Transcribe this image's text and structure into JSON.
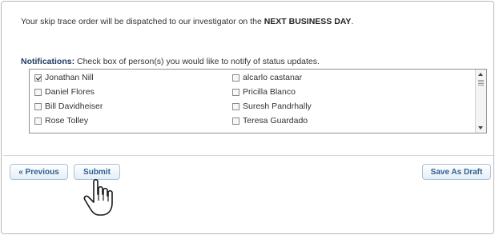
{
  "dispatch": {
    "prefix": "Your skip trace order will be dispatched to our investigator on the ",
    "emphasis": "NEXT BUSINESS DAY",
    "suffix": "."
  },
  "notifications": {
    "label": "Notifications:",
    "instruction": " Check box of person(s) you would like to notify of status updates.",
    "people": [
      {
        "name": "Jonathan Nill",
        "checked": true
      },
      {
        "name": "Daniel Flores",
        "checked": false
      },
      {
        "name": "Bill Davidheiser",
        "checked": false
      },
      {
        "name": "Rose Tolley",
        "checked": false
      },
      {
        "name": "alcarlo castanar",
        "checked": false
      },
      {
        "name": "Pricilla Blanco",
        "checked": false
      },
      {
        "name": "Suresh Pandrhally",
        "checked": false
      },
      {
        "name": "Teresa Guardado",
        "checked": false
      }
    ]
  },
  "buttons": {
    "previous": "« Previous",
    "submit": "Submit",
    "save_draft": "Save As Draft"
  },
  "colors": {
    "button_text": "#2e5f91",
    "button_border": "#a9c1d9",
    "label_text": "#1f3b63"
  },
  "icons": {
    "cursor": "hand-pointer-icon",
    "checkbox": "checkbox-icon"
  }
}
